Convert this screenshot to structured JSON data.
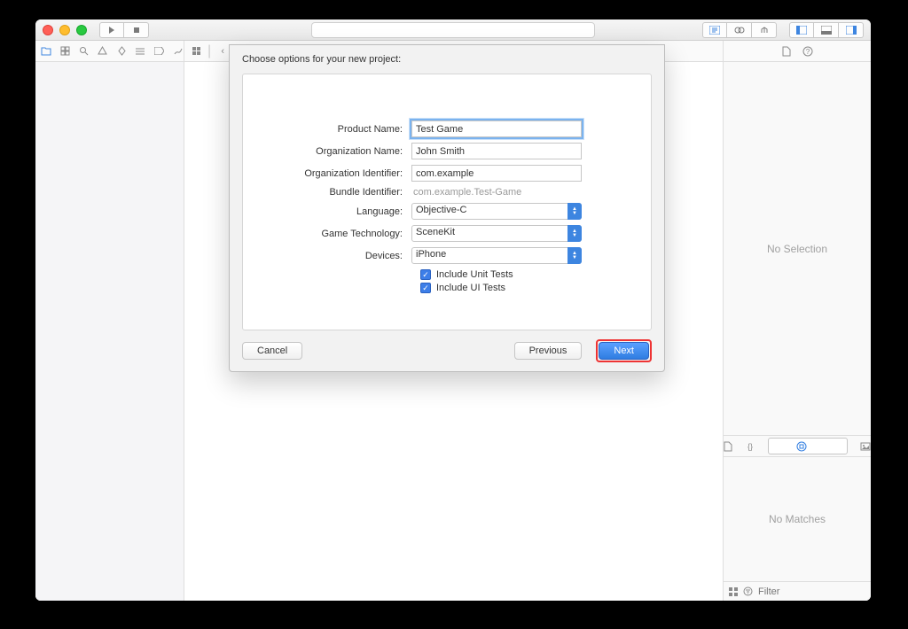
{
  "sheet": {
    "header": "Choose options for your new project:",
    "fields": {
      "product_name": {
        "label": "Product Name:",
        "value": "Test Game"
      },
      "org_name": {
        "label": "Organization Name:",
        "value": "John Smith"
      },
      "org_id": {
        "label": "Organization Identifier:",
        "value": "com.example"
      },
      "bundle_id": {
        "label": "Bundle Identifier:",
        "value": "com.example.Test-Game"
      },
      "language": {
        "label": "Language:",
        "value": "Objective-C"
      },
      "game_tech": {
        "label": "Game Technology:",
        "value": "SceneKit"
      },
      "devices": {
        "label": "Devices:",
        "value": "iPhone"
      },
      "unit_tests": {
        "label": "Include Unit Tests"
      },
      "ui_tests": {
        "label": "Include UI Tests"
      }
    },
    "buttons": {
      "cancel": "Cancel",
      "previous": "Previous",
      "next": "Next"
    }
  },
  "inspector": {
    "no_selection": "No Selection",
    "no_matches": "No Matches",
    "filter_placeholder": "Filter"
  }
}
